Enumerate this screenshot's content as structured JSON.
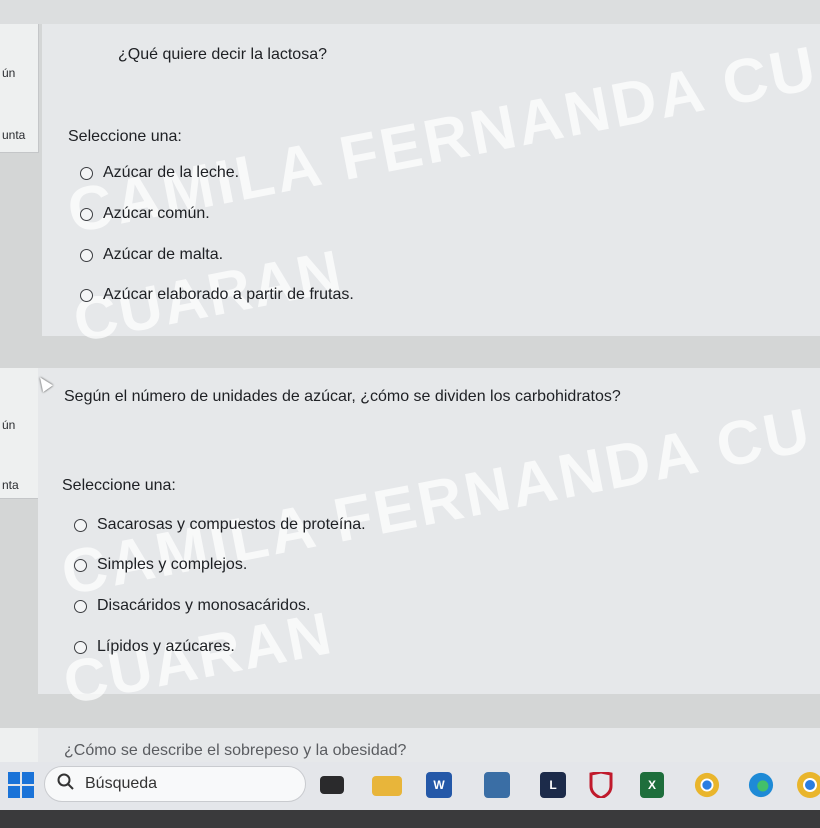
{
  "questions": [
    {
      "side_label_top": "ún",
      "side_label_bottom": "unta",
      "text": "¿Qué quiere decir la lactosa?",
      "prompt": "Seleccione una:",
      "options": [
        "Azúcar de la leche.",
        "Azúcar común.",
        "Azúcar de malta.",
        "Azúcar elaborado a partir de frutas."
      ]
    },
    {
      "side_label_top": "ún",
      "side_label_bottom": "nta",
      "text": "Según el número de unidades de azúcar, ¿cómo se dividen los carbohidratos?",
      "prompt": "Seleccione una:",
      "options": [
        "Sacarosas y compuestos de proteína.",
        "Simples y complejos.",
        "Disacáridos y monosacáridos.",
        "Lípidos y azúcares."
      ]
    }
  ],
  "next_question_partial": "¿Cómo se describe el sobrepeso y la obesidad?",
  "watermark": {
    "line1": "CAMILA FERNANDA CU",
    "line2": "CUARAN"
  },
  "taskbar": {
    "search_placeholder": "Búsqueda",
    "icons": [
      "windows-start",
      "search",
      "file-explorer",
      "folder",
      "word",
      "store",
      "l-app",
      "mcafee",
      "excel",
      "chrome",
      "edge",
      "chrome-2"
    ]
  },
  "colors": {
    "panel": "#e6e8ea",
    "background": "#d4d6d6",
    "taskbar": "#e4e6ea"
  }
}
